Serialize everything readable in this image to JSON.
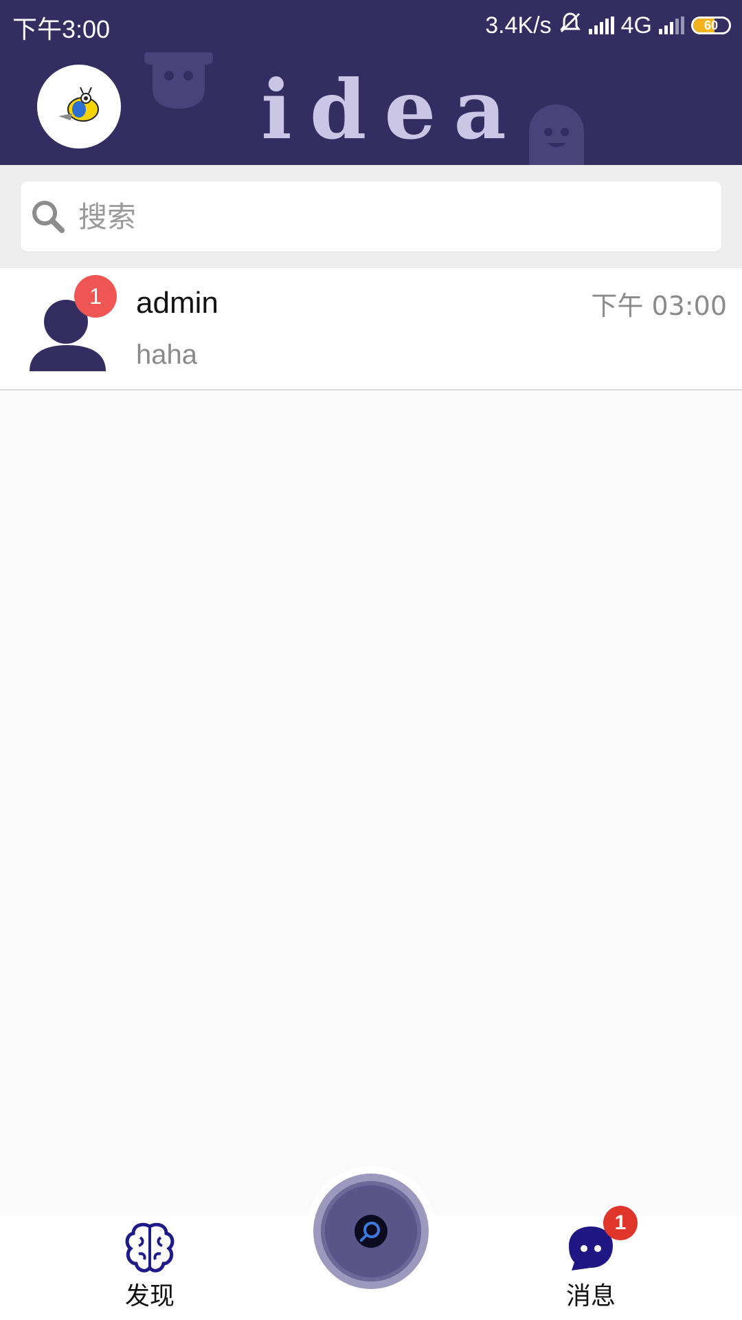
{
  "status_bar": {
    "time": "下午3:00",
    "net_speed": "3.4K/s",
    "network": "4G",
    "battery_level": "60",
    "battery_fraction": 0.6
  },
  "header": {
    "title": "idea"
  },
  "search": {
    "placeholder": "搜索"
  },
  "chats": [
    {
      "name": "admin",
      "preview": "haha",
      "time": "下午 03:00",
      "unread": "1"
    }
  ],
  "bottom_nav": {
    "discover_label": "发现",
    "messages_label": "消息",
    "messages_badge": "1"
  },
  "colors": {
    "primary": "#332d62",
    "badge_red": "#ef5552",
    "title_lavender": "#cbc5e6"
  }
}
